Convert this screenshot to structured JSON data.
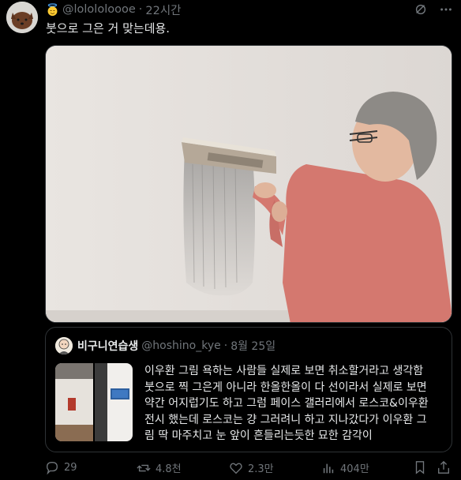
{
  "author": {
    "handle": "@lolololoooe",
    "separator": "·",
    "time": "22시간"
  },
  "tweet": {
    "text": "붓으로 그은 거 맞는데용."
  },
  "quote": {
    "name": "비구니연습생",
    "handle": "@hoshino_kye",
    "separator": "·",
    "date": "8월 25일",
    "lines": [
      "이우환 그림 욕하는 사람들 실제로 보면 취소할거라고 생각함",
      "붓으로 찍 그은게 아니라 한올한올이 다 선이라서 실제로 보면",
      "약간 어지럽기도 하고 그럼 페이스 갤러리에서 로스코&이우환",
      "전시 했는데 로스코는 걍 그러려니 하고 지나갔다가 이우환 그",
      "림 딱 마주치고 눈 앞이 흔들리는듯한 묘한 감각이"
    ]
  },
  "metrics": {
    "replies": "29",
    "reposts": "4.8천",
    "likes": "2.3만",
    "views": "404만"
  },
  "icons": {
    "avatar": "brown-dog-avatar",
    "angel": "angel-emoji-icon",
    "grok": "grok-icon",
    "more": "more-dots-icon",
    "reply": "reply-icon",
    "repost": "repost-icon",
    "like": "heart-icon",
    "views": "views-bar-chart-icon",
    "bookmark": "bookmark-icon",
    "share": "share-icon"
  },
  "colors": {
    "background": "#000000",
    "text": "#e7e9ea",
    "muted": "#71767b",
    "border": "#2f3336",
    "shirt": "#d4786f"
  }
}
